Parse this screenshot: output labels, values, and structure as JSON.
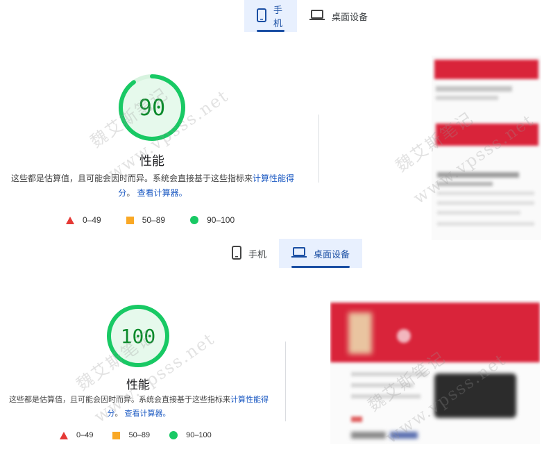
{
  "top": {
    "tabs": [
      {
        "label": "手机",
        "icon": "phone-icon",
        "active": true
      },
      {
        "label": "桌面设备",
        "icon": "laptop-icon",
        "active": false
      }
    ],
    "score": "90",
    "metric": "性能",
    "desc_prefix": "这些都是估算值，且可能会因时而异。系统会直接基于这些指标来",
    "desc_link1": "计算性能得分",
    "desc_mid": "。",
    "desc_link2": "查看计算器。",
    "legend": [
      "0–49",
      "50–89",
      "90–100"
    ]
  },
  "bottom": {
    "tabs": [
      {
        "label": "手机",
        "icon": "phone-icon",
        "active": false
      },
      {
        "label": "桌面设备",
        "icon": "laptop-icon",
        "active": true
      }
    ],
    "score": "100",
    "metric": "性能",
    "desc_prefix": "这些都是估算值，且可能会因时而异。系统会直接基于这些指标来",
    "desc_link1": "计算性能得分",
    "desc_mid": "。",
    "desc_link2": "查看计算器。",
    "legend": [
      "0–49",
      "50–89",
      "90–100"
    ]
  },
  "watermarks": [
    "魏艾斯笔记",
    "www.vpsss.net"
  ],
  "colors": {
    "accent": "#1a4ea3",
    "tab_active_bg": "#e8f0fe",
    "pass": "#18c964",
    "average": "#f9a825",
    "fail": "#e53935",
    "brand_red": "#d9243a"
  },
  "scores_numeric": {
    "mobile": 0.9,
    "desktop": 1.0
  }
}
